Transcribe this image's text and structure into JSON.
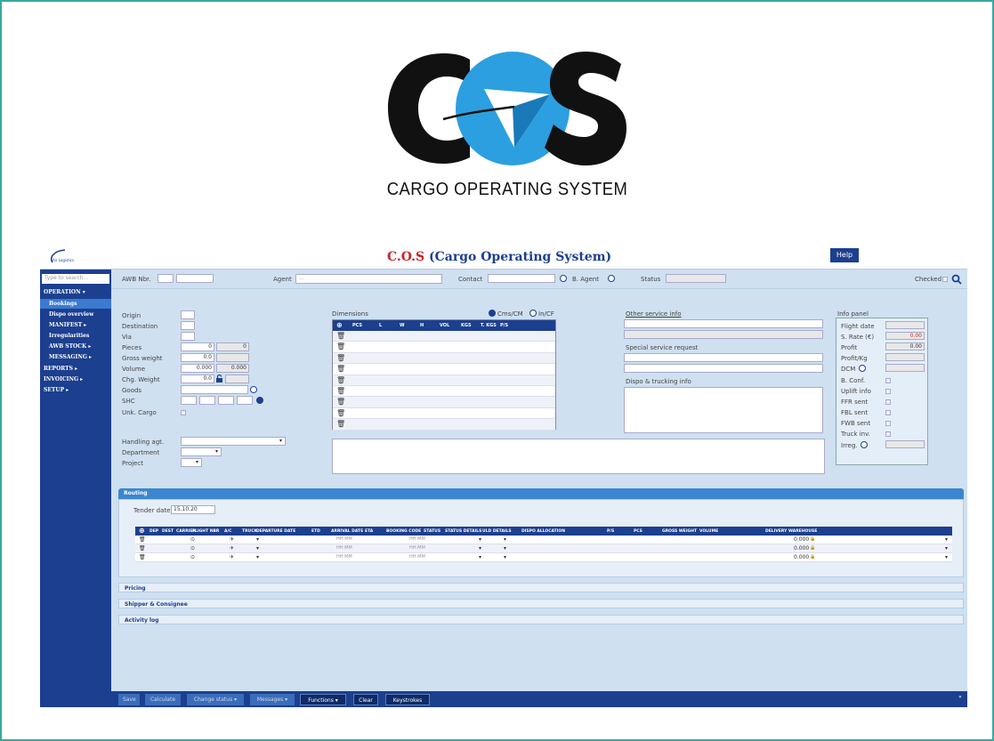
{
  "logo": {
    "subtitle": "CARGO OPERATING SYSTEM",
    "letters": "COS"
  },
  "app": {
    "brand_text": "Air Logistics",
    "title_prefix": "C.O.S",
    "title_rest": " (Cargo Operating System)",
    "help_label": "Help"
  },
  "sidebar": {
    "search_placeholder": "Type to search...",
    "items": [
      {
        "label": "OPERATION ▾",
        "kind": "top"
      },
      {
        "label": "Bookings",
        "kind": "active"
      },
      {
        "label": "Dispo overview",
        "kind": "sub"
      },
      {
        "label": "MANIFEST ▸",
        "kind": "sub"
      },
      {
        "label": "Irregularities",
        "kind": "sub"
      },
      {
        "label": "AWB STOCK ▸",
        "kind": "sub"
      },
      {
        "label": "MESSAGING ▸",
        "kind": "sub"
      },
      {
        "label": "REPORTS ▸",
        "kind": "top"
      },
      {
        "label": "INVOICING ▸",
        "kind": "top"
      },
      {
        "label": "SETUP ▸",
        "kind": "top"
      }
    ]
  },
  "header_row": {
    "awb_label": "AWB Nbr.",
    "agent_label": "Agent",
    "agent_value": "...",
    "contact_label": "Contact",
    "bagent_label": "B. Agent",
    "status_label": "Status",
    "checked_label": "Checked"
  },
  "shipment": {
    "origin_label": "Origin",
    "destination_label": "Destination",
    "via_label": "Via",
    "pieces_label": "Pieces",
    "pieces_value": "0",
    "pieces_value2": "0",
    "gross_weight_label": "Gross weight",
    "gross_weight_value": "0.0",
    "volume_label": "Volume",
    "volume_value": "0.000",
    "volume_value2": "0.000",
    "chg_weight_label": "Chg. Weight",
    "chg_weight_value": "0.0",
    "goods_label": "Goods",
    "shc_label": "SHC",
    "unk_cargo_label": "Unk. Cargo",
    "handling_label": "Handling agt.",
    "department_label": "Department",
    "project_label": "Project"
  },
  "dimensions": {
    "label": "Dimensions",
    "unit_cms": "Cms/CM",
    "unit_in": "In/CF",
    "columns": [
      "PCS",
      "L",
      "W",
      "H",
      "VOL",
      "KGS",
      "T. KGS",
      "P/S"
    ]
  },
  "services": {
    "other_label": "Other service info",
    "special_label": "Special service request",
    "dispo_label": "Dispo & trucking info"
  },
  "info_panel": {
    "title": "Info panel",
    "flight_date": "Flight date",
    "s_rate": "S. Rate (€)",
    "s_rate_value": "0.00",
    "profit": "Profit",
    "profit_value": "0.00",
    "profit_kg": "Profit/Kg",
    "dcm": "DCM",
    "b_conf": "B. Conf.",
    "uplift": "Uplift info",
    "ffr": "FFR sent",
    "fbl": "FBL sent",
    "fwb": "FWB sent",
    "truck": "Truck inv.",
    "irreg": "Irreg."
  },
  "routing": {
    "title": "Routing",
    "tender_label": "Tender date",
    "tender_value": "15.10.20",
    "columns": [
      "DEP",
      "DEST",
      "CARRIER",
      "FLIGHT NBR",
      "A/C",
      "TRUCK",
      "DEPARTURE DATE",
      "ETD",
      "ARRIVAL DATE",
      "ETA",
      "BOOKING CODE",
      "STATUS",
      "STATUS DETAILS",
      "ULD DETAILS",
      "DISPO ALLOCATION",
      "P/S",
      "PCS",
      "GROSS WEIGHT",
      "VOLUME",
      "DELIVERY WAREHOUSE"
    ],
    "rows": [
      {
        "etd": "HH:MM",
        "eta": "HH:MM",
        "volume": "0.000"
      },
      {
        "etd": "HH:MM",
        "eta": "HH:MM",
        "volume": "0.000"
      },
      {
        "etd": "HH:MM",
        "eta": "HH:MM",
        "volume": "0.000"
      }
    ]
  },
  "sections": [
    "Pricing",
    "Shipper & Consignee",
    "Activity log"
  ],
  "footer": {
    "buttons": [
      {
        "label": "Save",
        "enabled": false
      },
      {
        "label": "Calculate",
        "enabled": false
      },
      {
        "label": "Change status ▾",
        "enabled": false
      },
      {
        "label": "Messages ▾",
        "enabled": false
      },
      {
        "label": "Functions ▾",
        "enabled": true
      },
      {
        "label": "Clear",
        "enabled": true
      },
      {
        "label": "Keystrokes",
        "enabled": true
      }
    ]
  },
  "colors": {
    "brand_blue": "#1c3f8f",
    "accent_red": "#c4262b",
    "logo_blue": "#2c9fe0",
    "frame_teal": "#3aa89a"
  }
}
